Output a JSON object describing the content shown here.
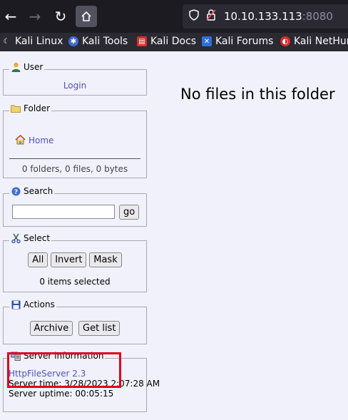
{
  "browser": {
    "url_host": "10.10.133.113",
    "url_port": ":8080",
    "bookmarks": [
      "Kali Linux",
      "Kali Tools",
      "Kali Docs",
      "Kali Forums",
      "Kali NetHunter"
    ]
  },
  "user": {
    "legend": "User",
    "login_link": "Login"
  },
  "folder": {
    "legend": "Folder",
    "home_link": "Home",
    "stats": "0 folders, 0 files, 0 bytes"
  },
  "search": {
    "legend": "Search",
    "value": "",
    "go_label": "go"
  },
  "select": {
    "legend": "Select",
    "all_label": "All",
    "invert_label": "Invert",
    "mask_label": "Mask",
    "selected_count": "0 items selected"
  },
  "actions": {
    "legend": "Actions",
    "archive_label": "Archive",
    "getlist_label": "Get list"
  },
  "server_info": {
    "legend": "Server information",
    "software_link": "HttpFileServer 2.3",
    "server_time": "Server time: 3/28/2023 2:07:28 AM",
    "server_uptime": "Server uptime: 00:05:15"
  },
  "main": {
    "message": "No files in this folder"
  },
  "colors": {
    "link": "#5050c8",
    "highlight_box": "#e0001a",
    "page_bg": "#f1f1fb"
  }
}
